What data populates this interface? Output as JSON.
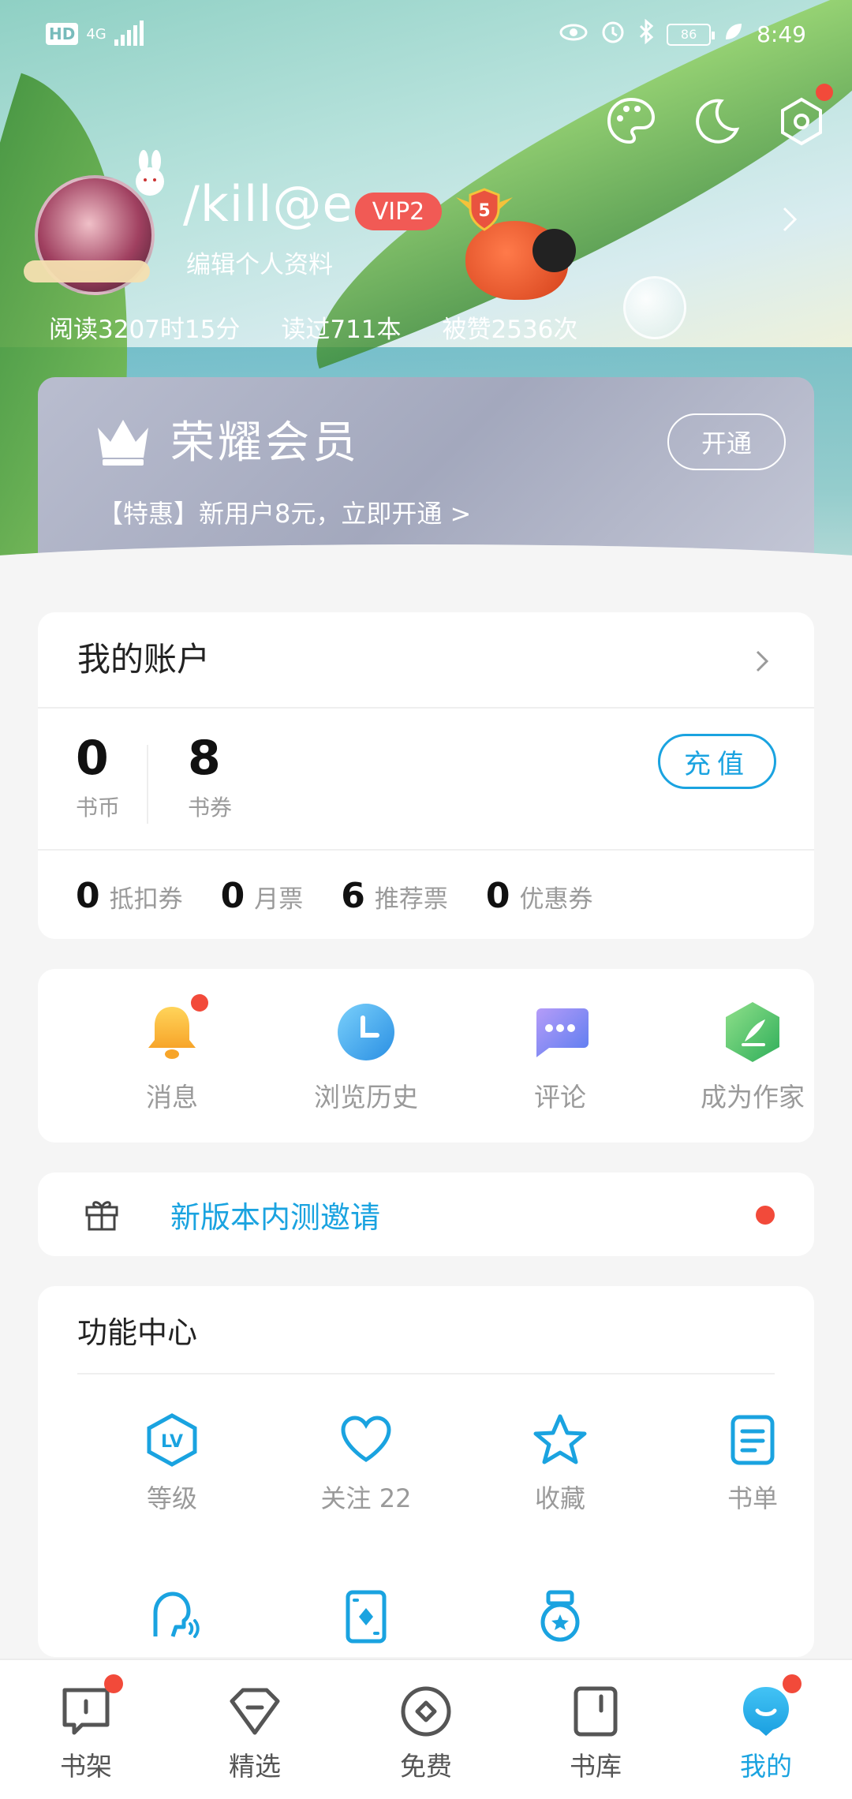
{
  "status_bar": {
    "hd": "HD",
    "network": "4G",
    "battery": "86",
    "time": "8:49"
  },
  "profile": {
    "username": "/kill@e",
    "vip_badge": "VIP2",
    "level": "5",
    "edit_label": "编辑个人资料",
    "stats": {
      "reading_time": "阅读3207时15分",
      "books_read": "读过711本",
      "likes": "被赞2536次"
    }
  },
  "vip_card": {
    "title": "荣耀会员",
    "open_label": "开通",
    "promo": "【特惠】新用户8元，立即开通 >"
  },
  "account": {
    "title": "我的账户",
    "coins_value": "0",
    "coins_label": "书币",
    "vouchers_value": "8",
    "vouchers_label": "书券",
    "recharge_label": "充值",
    "tickets": [
      {
        "num": "0",
        "label": "抵扣券"
      },
      {
        "num": "0",
        "label": "月票"
      },
      {
        "num": "6",
        "label": "推荐票"
      },
      {
        "num": "0",
        "label": "优惠券"
      }
    ]
  },
  "quick_actions": [
    {
      "label": "消息",
      "icon": "bell-icon"
    },
    {
      "label": "浏览历史",
      "icon": "clock-icon"
    },
    {
      "label": "评论",
      "icon": "chat-icon"
    },
    {
      "label": "成为作家",
      "icon": "pen-icon"
    }
  ],
  "invite": {
    "text": "新版本内测邀请"
  },
  "function_center": {
    "title": "功能中心",
    "items": [
      {
        "label": "等级",
        "icon": "level-icon"
      },
      {
        "label": "关注 22",
        "icon": "heart-icon"
      },
      {
        "label": "收藏",
        "icon": "star-icon"
      },
      {
        "label": "书单",
        "icon": "booklist-icon"
      }
    ]
  },
  "bottom_nav": [
    {
      "label": "书架",
      "icon": "bookshelf-icon"
    },
    {
      "label": "精选",
      "icon": "diamond-icon"
    },
    {
      "label": "免费",
      "icon": "free-icon"
    },
    {
      "label": "书库",
      "icon": "library-icon"
    },
    {
      "label": "我的",
      "icon": "profile-icon"
    }
  ],
  "colors": {
    "accent": "#1aa3e0",
    "red_dot": "#f24a3a",
    "vip_badge": "#f15a55"
  }
}
